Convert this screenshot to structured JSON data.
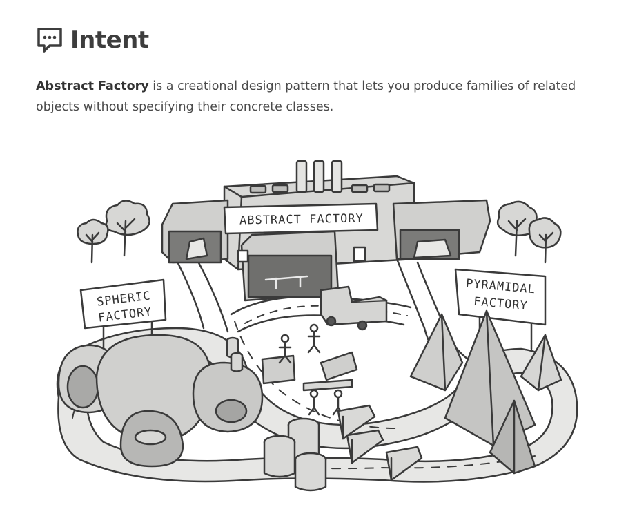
{
  "section": {
    "title": "Intent",
    "icon": "speech-bubble-icon"
  },
  "intro": {
    "term": "Abstract Factory",
    "text": " is a creational design pattern that lets you produce families of related objects without specifying their concrete classes."
  },
  "illustration": {
    "main_sign": "ABSTRACT FACTORY",
    "left_sign_line1": "SPHERIC",
    "left_sign_line2": "FACTORY",
    "right_sign_line1": "PYRAMIDAL",
    "right_sign_line2": "FACTORY"
  }
}
